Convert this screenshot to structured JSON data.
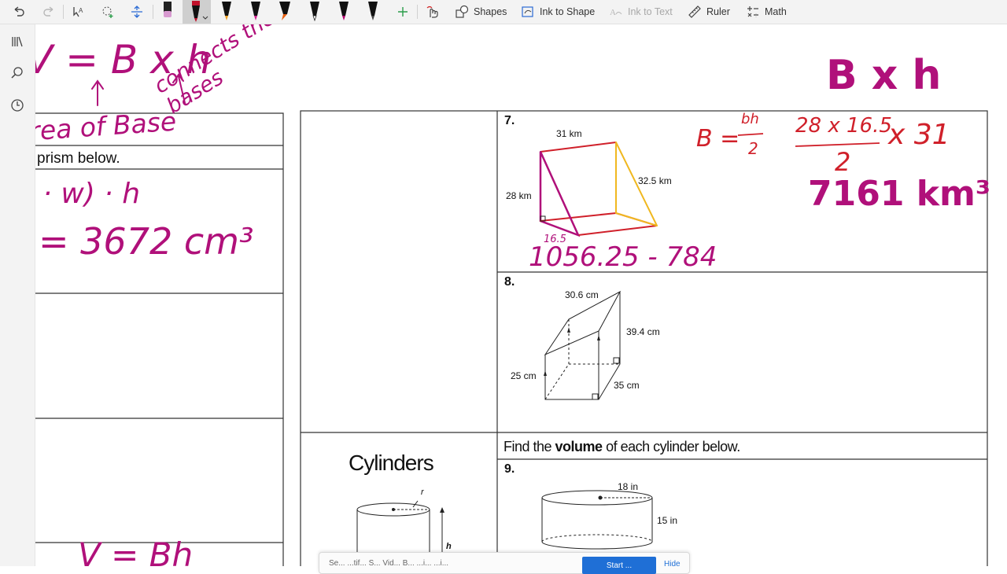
{
  "toolbar": {
    "shapes_label": "Shapes",
    "ink_to_shape_label": "Ink to Shape",
    "ink_to_text_label": "Ink to Text",
    "ruler_label": "Ruler",
    "math_label": "Math",
    "pen_colors": [
      "#d45fb0",
      "#c0102a",
      "#f0a020",
      "#d02090",
      "#e86010",
      "#222222",
      "#b0006e",
      "#444444"
    ]
  },
  "worksheet": {
    "left_col": {
      "fragment_area": "rea of Base",
      "fragment_prism": "prism below."
    },
    "problem7": {
      "number": "7.",
      "top_label": "31 km",
      "left_label": "28 km",
      "right_label": "32.5 km"
    },
    "problem8": {
      "number": "8.",
      "top_label": "30.6 cm",
      "right_label": "39.4 cm",
      "left_label": "25 cm",
      "bottom_label": "35 cm"
    },
    "cylinders_title": "Cylinders",
    "cylinder_diagram": {
      "r_label": "r",
      "h_label": "h"
    },
    "instruction_pre": "Find the ",
    "instruction_bold": "volume",
    "instruction_post": " of each cylinder below.",
    "problem9": {
      "number": "9.",
      "top_label": "18 in",
      "right_label": "15 in"
    }
  },
  "ink": {
    "formula_top": "V = B x h",
    "connects_bases": "connects the bases",
    "formula_lwh": "(l · w) · h",
    "answer_cm3": "= 3672 cm³",
    "b_times_h": "B x h",
    "b_formula_lhs": "B =",
    "b_frac_num": "bh",
    "b_frac_den": "2",
    "b_frac2_num": "28 x 16.5",
    "b_frac2_den": "2",
    "times_31": "x 31",
    "answer_km3": "7161 km³",
    "area_sub": "1056.25 - 784",
    "label_165": "16.5",
    "v_bh": "V = Bh"
  },
  "notification": {
    "text": "Se... ...tif... S... Vid... B... ...i... ...i...",
    "button": "Start ...",
    "hide": "Hide"
  },
  "colors": {
    "ink_magenta": "#b0107a",
    "ink_red": "#d0202a",
    "ink_yellow": "#f0b820",
    "accent": "#1f6fd6"
  }
}
